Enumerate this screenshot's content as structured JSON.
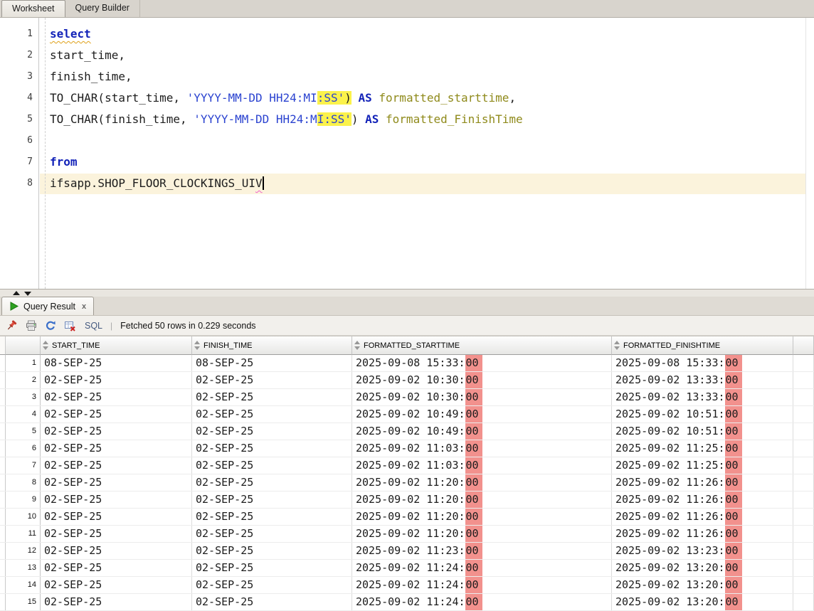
{
  "editor_tabs": {
    "worksheet": "Worksheet",
    "query_builder": "Query Builder"
  },
  "editor": {
    "lines": [
      {
        "n": "1",
        "segments": [
          {
            "t": "select",
            "c": "kw sqy"
          }
        ]
      },
      {
        "n": "2",
        "segments": [
          {
            "t": "start_time,",
            "c": "plain"
          }
        ]
      },
      {
        "n": "3",
        "segments": [
          {
            "t": "finish_time,",
            "c": "plain"
          }
        ]
      },
      {
        "n": "4",
        "segments": [
          {
            "t": "TO_CHAR(start_time, ",
            "c": "plain"
          },
          {
            "t": "'YYYY-MM-DD HH24:MI",
            "c": "str"
          },
          {
            "t": ":SS'",
            "c": "str hl"
          },
          {
            "t": ")",
            "c": "plain hl"
          },
          {
            "t": " ",
            "c": "plain"
          },
          {
            "t": "AS",
            "c": "kw"
          },
          {
            "t": " ",
            "c": "plain"
          },
          {
            "t": "formatted_starttime",
            "c": "alias"
          },
          {
            "t": ",",
            "c": "plain"
          }
        ]
      },
      {
        "n": "5",
        "segments": [
          {
            "t": "TO_CHAR(finish_time, ",
            "c": "plain"
          },
          {
            "t": "'YYYY-MM-DD HH24:M",
            "c": "str"
          },
          {
            "t": "I:SS'",
            "c": "str hl"
          },
          {
            "t": ") ",
            "c": "plain"
          },
          {
            "t": "AS",
            "c": "kw"
          },
          {
            "t": " ",
            "c": "plain"
          },
          {
            "t": "formatted_FinishTime",
            "c": "alias"
          }
        ]
      },
      {
        "n": "6",
        "segments": []
      },
      {
        "n": "7",
        "segments": [
          {
            "t": "from",
            "c": "kw"
          }
        ]
      },
      {
        "n": "8",
        "current": true,
        "cursor": true,
        "segments": [
          {
            "t": "ifsapp.SHOP_FLOOR_CLOCKINGS_UI",
            "c": "plain"
          },
          {
            "t": "V",
            "c": "plain sqp"
          }
        ]
      }
    ]
  },
  "result_panel": {
    "tab_label": "Query Result",
    "close_label": "x",
    "toolbar": {
      "sql_label": "SQL",
      "separator": "|",
      "status": "Fetched 50 rows in 0.229 seconds",
      "icon_names": [
        "pin-icon",
        "print-icon",
        "refresh-icon",
        "discard-results-icon"
      ]
    }
  },
  "grid": {
    "columns": [
      "START_TIME",
      "FINISH_TIME",
      "FORMATTED_STARTTIME",
      "FORMATTED_FINISHTIME"
    ],
    "highlight_seconds_columns": [
      2,
      3
    ],
    "rows": [
      {
        "n": "1",
        "cells": [
          "08-SEP-25",
          "08-SEP-25",
          "2025-09-08 15:33:00",
          "2025-09-08 15:33:00"
        ]
      },
      {
        "n": "2",
        "cells": [
          "02-SEP-25",
          "02-SEP-25",
          "2025-09-02 10:30:00",
          "2025-09-02 13:33:00"
        ]
      },
      {
        "n": "3",
        "cells": [
          "02-SEP-25",
          "02-SEP-25",
          "2025-09-02 10:30:00",
          "2025-09-02 13:33:00"
        ]
      },
      {
        "n": "4",
        "cells": [
          "02-SEP-25",
          "02-SEP-25",
          "2025-09-02 10:49:00",
          "2025-09-02 10:51:00"
        ]
      },
      {
        "n": "5",
        "cells": [
          "02-SEP-25",
          "02-SEP-25",
          "2025-09-02 10:49:00",
          "2025-09-02 10:51:00"
        ]
      },
      {
        "n": "6",
        "cells": [
          "02-SEP-25",
          "02-SEP-25",
          "2025-09-02 11:03:00",
          "2025-09-02 11:25:00"
        ]
      },
      {
        "n": "7",
        "cells": [
          "02-SEP-25",
          "02-SEP-25",
          "2025-09-02 11:03:00",
          "2025-09-02 11:25:00"
        ]
      },
      {
        "n": "8",
        "cells": [
          "02-SEP-25",
          "02-SEP-25",
          "2025-09-02 11:20:00",
          "2025-09-02 11:26:00"
        ]
      },
      {
        "n": "9",
        "cells": [
          "02-SEP-25",
          "02-SEP-25",
          "2025-09-02 11:20:00",
          "2025-09-02 11:26:00"
        ]
      },
      {
        "n": "10",
        "cells": [
          "02-SEP-25",
          "02-SEP-25",
          "2025-09-02 11:20:00",
          "2025-09-02 11:26:00"
        ]
      },
      {
        "n": "11",
        "cells": [
          "02-SEP-25",
          "02-SEP-25",
          "2025-09-02 11:20:00",
          "2025-09-02 11:26:00"
        ]
      },
      {
        "n": "12",
        "cells": [
          "02-SEP-25",
          "02-SEP-25",
          "2025-09-02 11:23:00",
          "2025-09-02 13:23:00"
        ]
      },
      {
        "n": "13",
        "cells": [
          "02-SEP-25",
          "02-SEP-25",
          "2025-09-02 11:24:00",
          "2025-09-02 13:20:00"
        ]
      },
      {
        "n": "14",
        "cells": [
          "02-SEP-25",
          "02-SEP-25",
          "2025-09-02 11:24:00",
          "2025-09-02 13:20:00"
        ]
      },
      {
        "n": "15",
        "cells": [
          "02-SEP-25",
          "02-SEP-25",
          "2025-09-02 11:24:00",
          "2025-09-02 13:20:00"
        ]
      }
    ]
  },
  "colors": {
    "selection_yellow": "#FBF24B",
    "seconds_highlight_red": "#F2918D",
    "current_line_beige": "#FBF3DC",
    "keyword_blue": "#1222B8",
    "string_blue": "#2B43D0",
    "alias_olive": "#8F8A1B",
    "play_green": "#2EA121",
    "pin_red": "#C0392B"
  }
}
